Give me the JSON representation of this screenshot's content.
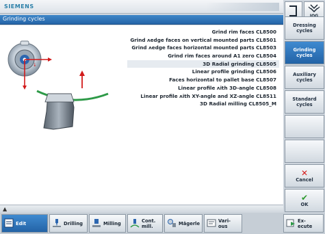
{
  "brand": "SIEMENS",
  "header": {
    "title": "Grinding cycles"
  },
  "cycles": [
    "Grind rim faces CL8500",
    "Grind ʌedge faces on vertical mounted parts CL8501",
    "Grind ʌedge faces horizontal mounted parts CL8503",
    "Grind rim faces around A1 zero CL8504",
    "3D Radial grinding CL8505",
    "Linear profile grinding CL8506",
    "Faces horizontal to pallet base CL8507",
    "Linear profile ʌith 3D-angle CL8508",
    "Linear profile ʌith XY-angle and XZ-angle CL8511",
    "3D Radial milling CL8505_M"
  ],
  "selected_cycle_index": 4,
  "top_right": {
    "jog_label": "JOG",
    "bracket_icon": "bracket-icon",
    "jog_icon": "jog-icon"
  },
  "vertical_softkeys": [
    {
      "label_1": "Dressing",
      "label_2": "cycles",
      "active": false
    },
    {
      "label_1": "Grinding",
      "label_2": "cycles",
      "active": true
    },
    {
      "label_1": "Auxiliary",
      "label_2": "cycles",
      "active": false
    },
    {
      "label_1": "Standard",
      "label_2": "cycles",
      "active": false
    },
    {
      "label_1": "",
      "label_2": "",
      "active": false
    },
    {
      "label_1": "",
      "label_2": "",
      "active": false
    },
    {
      "label_1": "Cancel",
      "label_2": "",
      "mark": "✕",
      "mark_color": "#d42020",
      "active": false
    },
    {
      "label_1": "OK",
      "label_2": "",
      "mark": "✔",
      "mark_color": "#2e9a2e",
      "active": false
    }
  ],
  "bottom_softkeys": [
    {
      "label_1": "Edit",
      "label_2": "",
      "icon": "edit-icon",
      "active": true
    },
    {
      "label_1": "Drilling",
      "label_2": "",
      "icon": "drilling-icon",
      "active": false
    },
    {
      "label_1": "Milling",
      "label_2": "",
      "icon": "milling-icon",
      "active": false
    },
    {
      "label_1": "Cont.",
      "label_2": "mill.",
      "icon": "contour-milling-icon",
      "active": false
    },
    {
      "label_1": "Mägerle",
      "label_2": "",
      "icon": "maegerle-icon",
      "active": false
    },
    {
      "label_1": "Vari-",
      "label_2": "ous",
      "icon": "various-icon",
      "active": false
    },
    {
      "label_1": "Ex-",
      "label_2": "ecute",
      "icon": "execute-icon",
      "active": false
    }
  ],
  "colors": {
    "accent": "#2565a8",
    "selected_row": "#e6ebf0",
    "cancel": "#d42020",
    "ok": "#2e9a2e"
  }
}
